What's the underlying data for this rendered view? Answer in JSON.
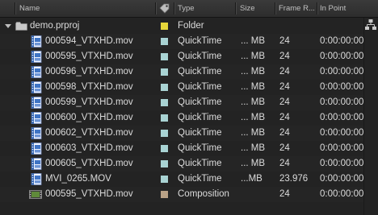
{
  "columns": {
    "name": "Name",
    "type": "Type",
    "size": "Size",
    "frame_rate": "Frame R...",
    "in_point": "In Point"
  },
  "folder": {
    "name": "demo.prproj",
    "label_color": "#e6d63a",
    "type": "Folder"
  },
  "items": [
    {
      "name": "000594_VTXHD.mov",
      "label_color": "#a9d3d3",
      "type": "QuickTime",
      "size": "... MB",
      "frame_rate": "24",
      "in_point": "0:00:00:00"
    },
    {
      "name": "000595_VTXHD.mov",
      "label_color": "#a9d3d3",
      "type": "QuickTime",
      "size": "... MB",
      "frame_rate": "24",
      "in_point": "0:00:00:00"
    },
    {
      "name": "000596_VTXHD.mov",
      "label_color": "#a9d3d3",
      "type": "QuickTime",
      "size": "... MB",
      "frame_rate": "24",
      "in_point": "0:00:00:00"
    },
    {
      "name": "000598_VTXHD.mov",
      "label_color": "#a9d3d3",
      "type": "QuickTime",
      "size": "... MB",
      "frame_rate": "24",
      "in_point": "0:00:00:00"
    },
    {
      "name": "000599_VTXHD.mov",
      "label_color": "#a9d3d3",
      "type": "QuickTime",
      "size": "... MB",
      "frame_rate": "24",
      "in_point": "0:00:00:00"
    },
    {
      "name": "000600_VTXHD.mov",
      "label_color": "#a9d3d3",
      "type": "QuickTime",
      "size": "... MB",
      "frame_rate": "24",
      "in_point": "0:00:00:00"
    },
    {
      "name": "000602_VTXHD.mov",
      "label_color": "#a9d3d3",
      "type": "QuickTime",
      "size": "... MB",
      "frame_rate": "24",
      "in_point": "0:00:00:00"
    },
    {
      "name": "000603_VTXHD.mov",
      "label_color": "#a9d3d3",
      "type": "QuickTime",
      "size": "... MB",
      "frame_rate": "24",
      "in_point": "0:00:00:00"
    },
    {
      "name": "000605_VTXHD.mov",
      "label_color": "#a9d3d3",
      "type": "QuickTime",
      "size": "... MB",
      "frame_rate": "24",
      "in_point": "0:00:00:00"
    },
    {
      "name": "MVI_0265.MOV",
      "label_color": "#a9d3d3",
      "type": "QuickTime",
      "size": "...MB",
      "frame_rate": "23.976",
      "in_point": "0:00:00:00"
    }
  ],
  "composition": {
    "name": "000595_VTXHD.mov",
    "label_color": "#b9a286",
    "type": "Composition",
    "frame_rate": "24",
    "in_point": "0:00:00:00"
  },
  "icons": {
    "label_header": "label-tag-icon",
    "expand": "disclosure-triangle-icon",
    "folder": "folder-icon",
    "footage": "quicktime-clip-icon",
    "composition": "composition-icon",
    "flowchart": "project-flowchart-icon"
  }
}
